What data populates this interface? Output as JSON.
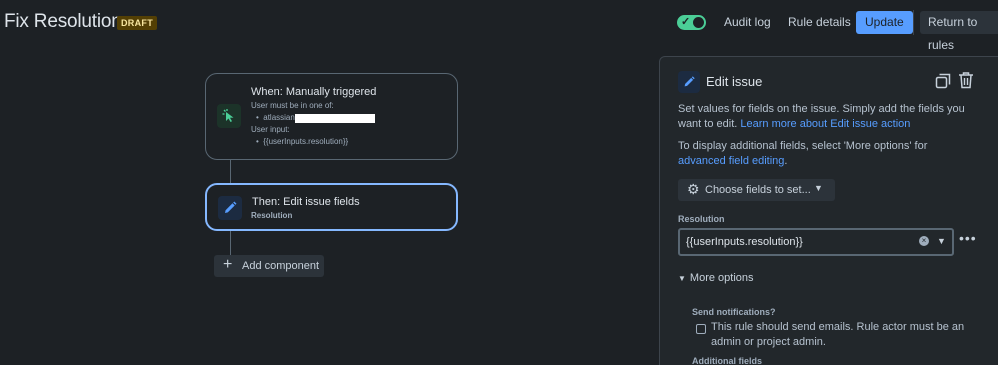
{
  "header": {
    "title": "Fix Resolution",
    "status_badge": "DRAFT",
    "toggle_enabled": true,
    "audit_log": "Audit log",
    "rule_details": "Rule details",
    "update": "Update",
    "return_to_rules": "Return to rules"
  },
  "canvas": {
    "trigger": {
      "title": "When: Manually triggered",
      "line1": "User must be in one of:",
      "group": "atlassian",
      "line2": "User input:",
      "input": "{{userInputs.resolution}}",
      "icon": "cursor-click-icon"
    },
    "action": {
      "title": "Then: Edit issue fields",
      "subtitle": "Resolution",
      "icon": "pencil-icon"
    },
    "add_component": "Add component"
  },
  "panel": {
    "title": "Edit issue",
    "description": "Set values for fields on the issue. Simply add the fields you want to edit.",
    "learn_more": "Learn more about Edit issue action",
    "more_text": "To display additional fields, select 'More options' for",
    "advanced_link": "advanced field editing",
    "period": ".",
    "choose_fields": "Choose fields to set...",
    "resolution_label": "Resolution",
    "resolution_value": "{{userInputs.resolution}}",
    "more_options": "More options",
    "send_notifications_label": "Send notifications?",
    "send_notifications_text": "This rule should send emails. Rule actor must be an admin or project admin.",
    "additional_fields_label": "Additional fields"
  },
  "colors": {
    "accent": "#579dff",
    "toggle_on": "#4bce97",
    "background": "#1d2125",
    "panel": "#22272b"
  }
}
